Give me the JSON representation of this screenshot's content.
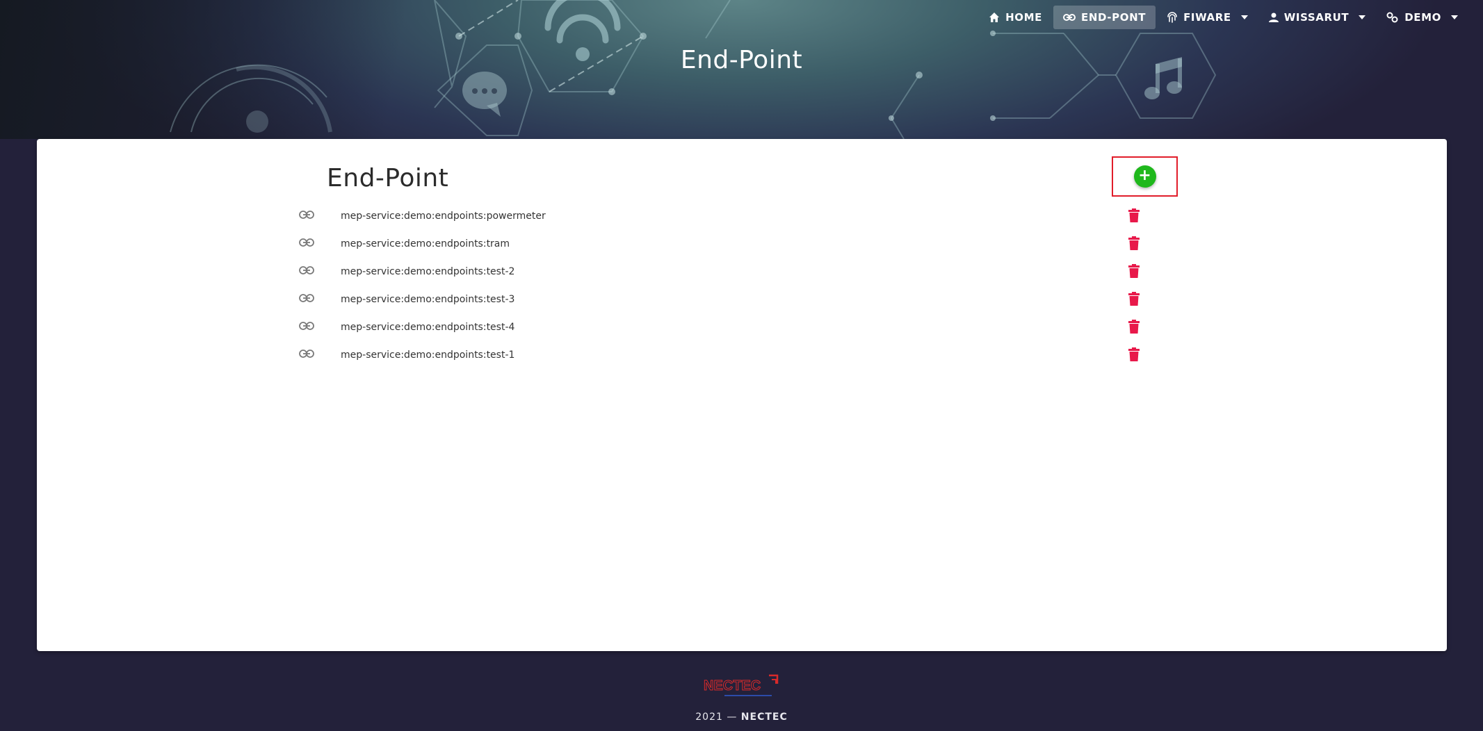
{
  "nav": {
    "home": "HOME",
    "endpoint": "END-PONT",
    "fiware": "FIWARE",
    "user": "WISSARUT",
    "demo": "DEMO"
  },
  "header": {
    "title": "End-Point"
  },
  "card": {
    "title": "End-Point",
    "add_label": "+",
    "endpoints": [
      "mep-service:demo:endpoints:powermeter",
      "mep-service:demo:endpoints:tram",
      "mep-service:demo:endpoints:test-2",
      "mep-service:demo:endpoints:test-3",
      "mep-service:demo:endpoints:test-4",
      "mep-service:demo:endpoints:test-1"
    ]
  },
  "footer": {
    "logo_text": "NECTEC",
    "year": "2021",
    "dash": "—",
    "org": "NECTEC"
  },
  "colors": {
    "add": "#1fb81c",
    "delete": "#e8194a",
    "highlight_box": "#e11d2a",
    "background": "#23213a"
  },
  "icons": {
    "home": "home-icon",
    "endpoint": "link-icon",
    "fiware": "fingerprint-icon",
    "user": "person-icon",
    "demo": "gears-icon",
    "row": "link-icon",
    "delete": "trash-icon"
  }
}
